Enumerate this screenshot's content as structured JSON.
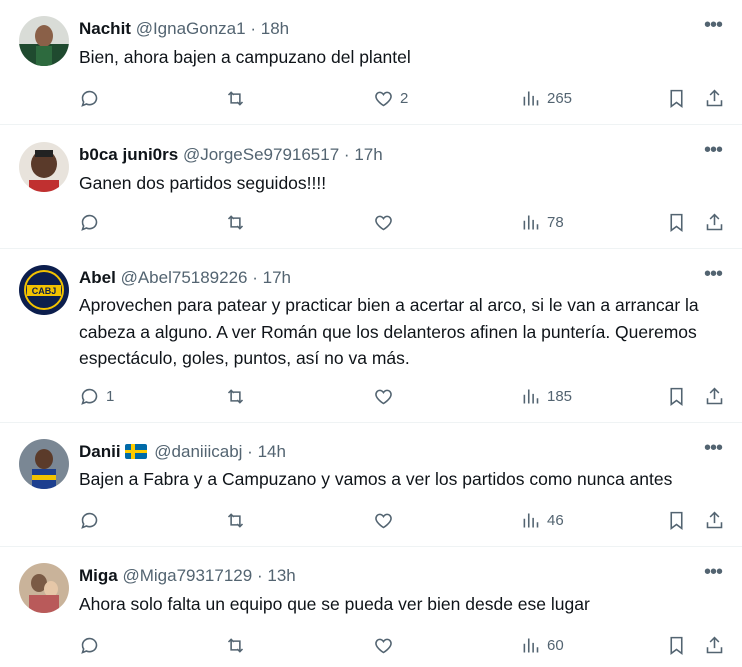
{
  "tweets": [
    {
      "name": "Nachit",
      "handle": "@IgnaGonza1",
      "time": "18h",
      "text": "Bien, ahora bajen a campuzano del plantel",
      "replies": "",
      "retweets": "",
      "likes": "2",
      "views": "265"
    },
    {
      "name": "b0ca juni0rs",
      "handle": "@JorgeSe97916517",
      "time": "17h",
      "text": "Ganen dos partidos seguidos!!!!",
      "replies": "",
      "retweets": "",
      "likes": "",
      "views": "78"
    },
    {
      "name": "Abel",
      "handle": "@Abel75189226",
      "time": "17h",
      "text": "Aprovechen para patear y practicar bien a acertar al arco, si le van a arrancar la cabeza a alguno. A ver Román que  los delanteros afinen la puntería. Queremos espectáculo, goles, puntos, así no va más.",
      "replies": "1",
      "retweets": "",
      "likes": "",
      "views": "185",
      "avatar_text": "CABJ"
    },
    {
      "name": "Danii",
      "handle": "@daniiicabj",
      "time": "14h",
      "text": "Bajen a Fabra y a Campuzano y vamos a ver los partidos como nunca antes",
      "replies": "",
      "retweets": "",
      "likes": "",
      "views": "46"
    },
    {
      "name": "Miga",
      "handle": "@Miga79317129",
      "time": "13h",
      "text": "Ahora solo falta un equipo que se pueda ver bien desde ese lugar",
      "replies": "",
      "retweets": "",
      "likes": "",
      "views": "60"
    }
  ],
  "separator": "·",
  "more_glyph": "•••"
}
